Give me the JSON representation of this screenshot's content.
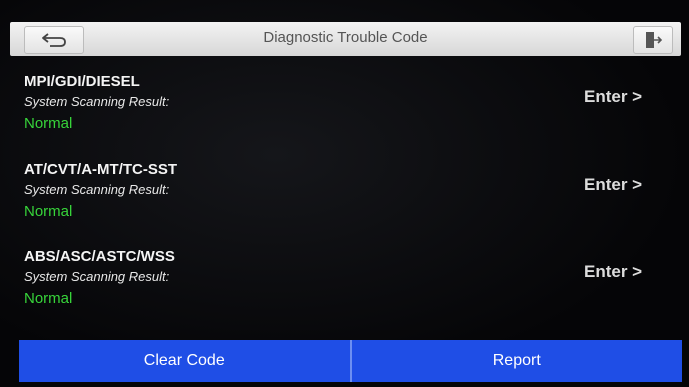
{
  "header": {
    "title": "Diagnostic Trouble Code",
    "back_icon": "back-arrow-icon",
    "exit_icon": "exit-icon"
  },
  "systems": [
    {
      "name": "MPI/GDI/DIESEL",
      "scan_label": "System Scanning Result:",
      "status": "Normal",
      "enter_label": "Enter >"
    },
    {
      "name": "AT/CVT/A-MT/TC-SST",
      "scan_label": "System Scanning Result:",
      "status": "Normal",
      "enter_label": "Enter >"
    },
    {
      "name": "ABS/ASC/ASTC/WSS",
      "scan_label": "System Scanning Result:",
      "status": "Normal",
      "enter_label": "Enter >"
    }
  ],
  "footer": {
    "clear_label": "Clear Code",
    "report_label": "Report"
  },
  "colors": {
    "status_ok": "#37d43a",
    "button_bar": "#1f4ee6"
  }
}
